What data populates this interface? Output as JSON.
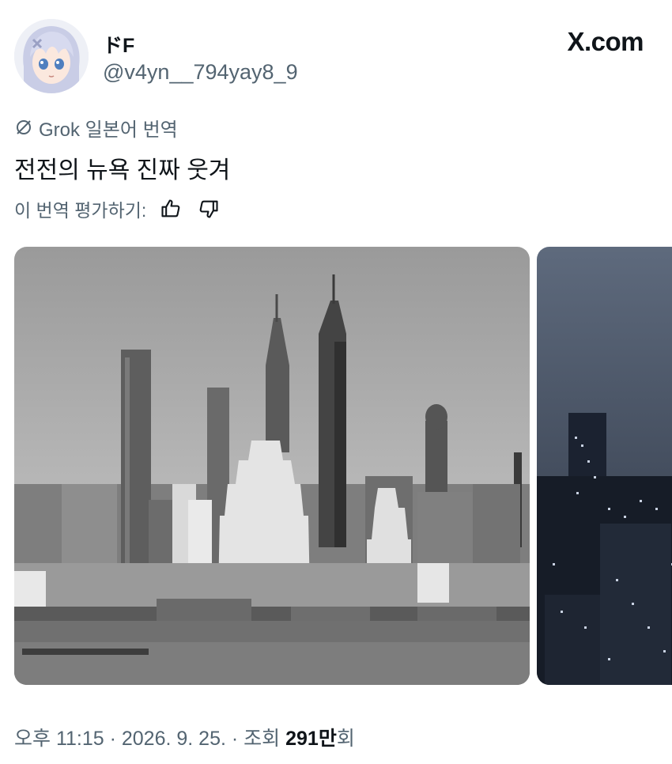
{
  "author": {
    "display_name": "ドF",
    "handle": "@v4yn__794yay8_9"
  },
  "brand": "X.com",
  "translation": {
    "label": "Grok 일본어 번역",
    "icon": "grok-icon"
  },
  "tweet": {
    "text": "전전의 뉴욕 진짜 웃겨"
  },
  "rating": {
    "label": "이 번역 평가하기:",
    "up_icon": "thumbs-up-icon",
    "down_icon": "thumbs-down-icon"
  },
  "media": {
    "count": 2
  },
  "meta": {
    "time": "오후 11:15",
    "separator": " · ",
    "date": "2026. 9. 25.",
    "views_prefix": "조회 ",
    "views_count": "291만",
    "views_suffix": "회"
  },
  "colors": {
    "text": "#0f1419",
    "secondary": "#536471"
  }
}
